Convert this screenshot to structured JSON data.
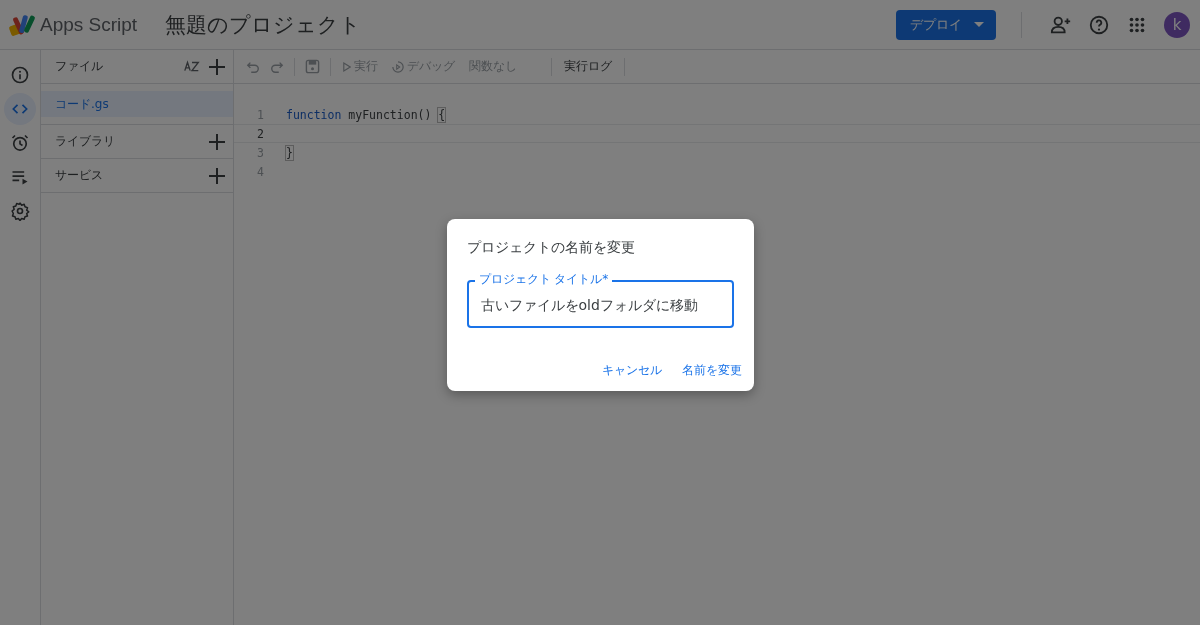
{
  "header": {
    "app_name": "Apps Script",
    "project_title": "無題のプロジェクト",
    "deploy_button": "デプロイ",
    "avatar_letter": "k"
  },
  "rail": [
    {
      "kind": "info",
      "selected": false
    },
    {
      "kind": "code",
      "selected": true
    },
    {
      "kind": "alarm",
      "selected": false
    },
    {
      "kind": "executions",
      "selected": false
    },
    {
      "kind": "settings",
      "selected": false
    }
  ],
  "files_panel": {
    "title": "ファイル",
    "files": [
      {
        "name": "コード.gs",
        "selected": true
      }
    ],
    "sections": [
      {
        "label": "ライブラリ"
      },
      {
        "label": "サービス"
      }
    ]
  },
  "toolbar": {
    "run": "実行",
    "debug": "デバッグ",
    "function_select": "関数なし",
    "log": "実行ログ"
  },
  "editor": {
    "lines": [
      {
        "number": "1",
        "current": false,
        "tokens": [
          {
            "kind": "keyword",
            "text": "function"
          },
          {
            "kind": "plain",
            "text": " myFunction() "
          },
          {
            "kind": "bracket",
            "text": "{"
          }
        ]
      },
      {
        "number": "2",
        "current": true
      },
      {
        "number": "3",
        "current": false,
        "tokens": [
          {
            "kind": "bracket",
            "text": "}"
          }
        ]
      },
      {
        "number": "4",
        "current": false
      }
    ]
  },
  "dialog": {
    "title": "プロジェクトの名前を変更",
    "field_label": "プロジェクト タイトル*",
    "field_value": "古いファイルをoldフォルダに移動",
    "buttons": [
      "キャンセル",
      "名前を変更"
    ]
  }
}
